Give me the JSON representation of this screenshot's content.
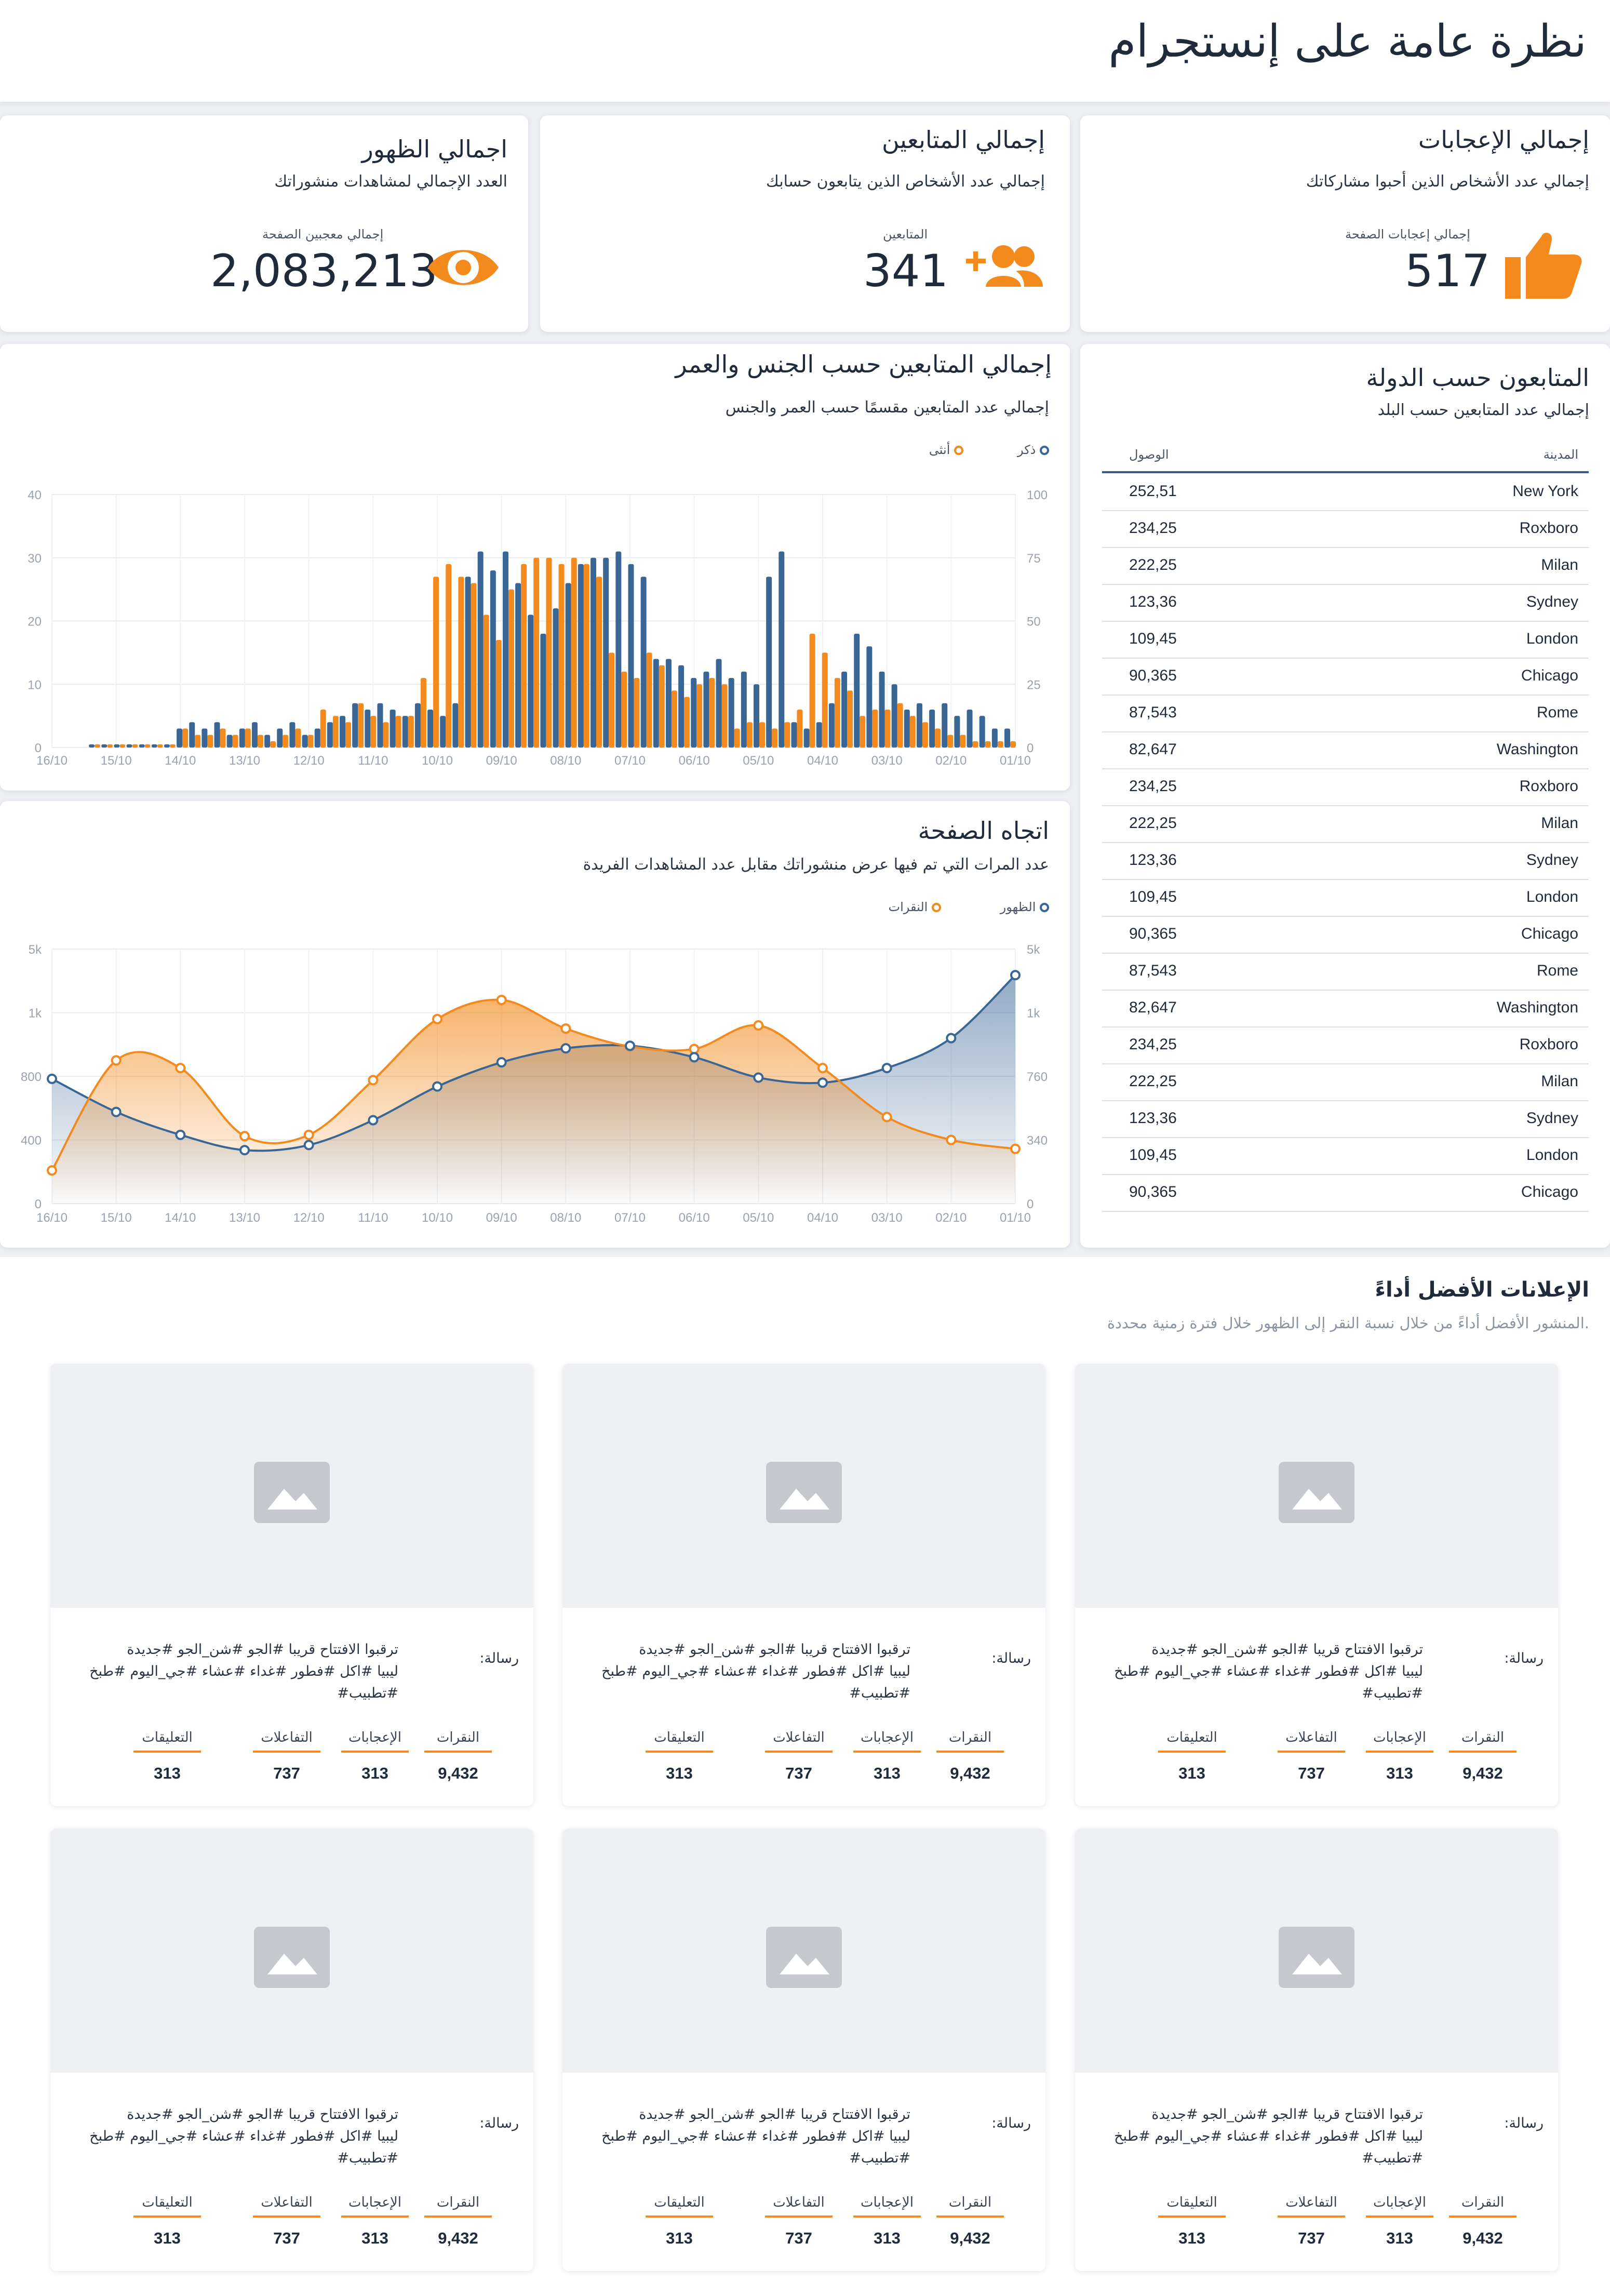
{
  "page": {
    "title": "نظرة عامة على إنستجرام"
  },
  "colors": {
    "accent": "#f28a1d",
    "primary": "#3a6696",
    "background": "#eef0f4",
    "card": "#ffffff"
  },
  "kpis": {
    "likes": {
      "title": "إجمالي الإعجابات",
      "subtitle": "إجمالي عدد الأشخاص الذين أحبوا مشاركاتك",
      "metric_label": "إجمالي إعجابات الصفحة",
      "value": "517",
      "icon": "thumbs-up-icon"
    },
    "followers": {
      "title": "إجمالي المتابعين",
      "subtitle": "إجمالي عدد الأشخاص الذين يتابعون حسابك",
      "metric_label": "المتابعين",
      "value": "341",
      "icon": "add-users-icon"
    },
    "impressions": {
      "title": "اجمالي الظهور",
      "subtitle": "العدد الإجمالي لمشاهدات منشوراتك",
      "metric_label": "إجمالي معجبين الصفحة",
      "value": "2,083,213",
      "icon": "eye-icon"
    }
  },
  "country_table": {
    "title": "المتابعون حسب الدولة",
    "subtitle": "إجمالي عدد المتابعين حسب البلد",
    "col_city": "المدينة",
    "col_reach": "الوصول",
    "rows": [
      {
        "city": "New York",
        "value": "252,51"
      },
      {
        "city": "Roxboro",
        "value": "234,25"
      },
      {
        "city": "Milan",
        "value": "222,25"
      },
      {
        "city": "Sydney",
        "value": "123,36"
      },
      {
        "city": "London",
        "value": "109,45"
      },
      {
        "city": "Chicago",
        "value": "90,365"
      },
      {
        "city": "Rome",
        "value": "87,543"
      },
      {
        "city": "Washington",
        "value": "82,647"
      },
      {
        "city": "Roxboro",
        "value": "234,25"
      },
      {
        "city": "Milan",
        "value": "222,25"
      },
      {
        "city": "Sydney",
        "value": "123,36"
      },
      {
        "city": "London",
        "value": "109,45"
      },
      {
        "city": "Chicago",
        "value": "90,365"
      },
      {
        "city": "Rome",
        "value": "87,543"
      },
      {
        "city": "Washington",
        "value": "82,647"
      },
      {
        "city": "Roxboro",
        "value": "234,25"
      },
      {
        "city": "Milan",
        "value": "222,25"
      },
      {
        "city": "Sydney",
        "value": "123,36"
      },
      {
        "city": "London",
        "value": "109,45"
      },
      {
        "city": "Chicago",
        "value": "90,365"
      }
    ]
  },
  "chart_data": [
    {
      "type": "bar",
      "title": "إجمالي المتابعين حسب الجنس والعمر",
      "subtitle": "إجمالي عدد المتابعين مقسمًا حسب العمر والجنس",
      "x_ticks": [
        "16/10",
        "15/10",
        "14/10",
        "13/10",
        "12/10",
        "11/10",
        "10/10",
        "09/10",
        "08/10",
        "07/10",
        "06/10",
        "05/10",
        "04/10",
        "03/10",
        "02/10",
        "01/10"
      ],
      "y_left_ticks": [
        "0",
        "10",
        "20",
        "30",
        "40"
      ],
      "y_right_ticks": [
        "0",
        "25",
        "50",
        "75",
        "100"
      ],
      "ylim": [
        0,
        40
      ],
      "legend_position": "top-right",
      "grid": true,
      "series": [
        {
          "name": "ذكر",
          "color": "#3a6696",
          "values": [
            0.5,
            0.5,
            0.5,
            0.5,
            0.5,
            0.5,
            0.5,
            3,
            4,
            3,
            4,
            2,
            3,
            4,
            2,
            3,
            4,
            2,
            3,
            4,
            5,
            7,
            6,
            7,
            6,
            5,
            7,
            6,
            5,
            7,
            27,
            31,
            28,
            31,
            26,
            21,
            18,
            22,
            26,
            29,
            30,
            30,
            31,
            29,
            27,
            14,
            14,
            13,
            11,
            12,
            14,
            11,
            12,
            10,
            27,
            31,
            4,
            3,
            4,
            7,
            12,
            18,
            16,
            12,
            10,
            6,
            7,
            6,
            7,
            5,
            6,
            5,
            3,
            3
          ]
        },
        {
          "name": "أنثى",
          "color": "#f28a1d",
          "values": [
            0.5,
            0.5,
            0.5,
            0.5,
            0.5,
            0.5,
            0.5,
            3,
            2,
            2,
            3,
            2,
            3,
            2,
            1,
            2,
            3,
            2,
            6,
            5,
            4,
            7,
            5,
            4,
            5,
            5,
            11,
            27,
            29,
            27,
            26,
            21,
            17,
            25,
            29,
            30,
            30,
            29,
            30,
            29,
            27,
            15,
            12,
            11,
            15,
            13,
            9,
            8,
            10,
            11,
            10,
            3,
            4,
            4,
            3,
            4,
            6,
            18,
            15,
            11,
            9,
            5,
            6,
            6,
            7,
            5,
            4,
            3,
            2,
            2,
            1,
            1,
            1,
            1
          ]
        }
      ]
    },
    {
      "type": "area",
      "title": "اتجاه الصفحة",
      "subtitle": "عدد المرات التي تم فيها عرض منشوراتك مقابل عدد المشاهدات الفريدة",
      "x_ticks": [
        "16/10",
        "15/10",
        "14/10",
        "13/10",
        "12/10",
        "11/10",
        "10/10",
        "09/10",
        "08/10",
        "07/10",
        "06/10",
        "05/10",
        "04/10",
        "03/10",
        "02/10",
        "01/10"
      ],
      "y_left_ticks": [
        "0",
        "400",
        "800",
        "1k",
        "5k"
      ],
      "y_right_ticks": [
        "0",
        "340",
        "760",
        "1k",
        "5k"
      ],
      "legend_position": "top-right",
      "grid": true,
      "series": [
        {
          "name": "الظهور",
          "color": "#3a6696",
          "values": [
            196,
            144,
            108,
            84,
            92,
            131,
            184,
            222,
            244,
            248,
            230,
            198,
            190,
            213,
            260,
            359
          ]
        },
        {
          "name": "النقرات",
          "color": "#f28a1d",
          "values": [
            52,
            225,
            213,
            106,
            108,
            194,
            290,
            320,
            275,
            247,
            243,
            280,
            213,
            136,
            100,
            86
          ]
        }
      ]
    }
  ],
  "ads": {
    "title": "الإعلانات الأفضل أداءً",
    "subtitle": ".المنشور الأفضل أداءً من خلال نسبة النقر إلى الظهور خلال فترة زمنية محددة",
    "message_label": "رسالة:",
    "stat_labels": {
      "clicks": "النقرات",
      "likes": "الإعجابات",
      "interactions": "التفاعلات",
      "comments": "التعليقات"
    },
    "items": [
      {
        "message_line1": "ترقبوا الافتتاح قريبا #الجو #شن_الجو #جديدة",
        "message_line2": "ليبيا #اكل #فطور #غداء #عشاء #جي_اليوم #طبخ #تطبيب#",
        "clicks": "9,432",
        "likes": "313",
        "interactions": "737",
        "comments": "313"
      },
      {
        "message_line1": "ترقبوا الافتتاح قريبا #الجو #شن_الجو #جديدة",
        "message_line2": "ليبيا #اكل #فطور #غداء #عشاء #جي_اليوم #طبخ #تطبيب#",
        "clicks": "9,432",
        "likes": "313",
        "interactions": "737",
        "comments": "313"
      },
      {
        "message_line1": "ترقبوا الافتتاح قريبا #الجو #شن_الجو #جديدة",
        "message_line2": "ليبيا #اكل #فطور #غداء #عشاء #جي_اليوم #طبخ #تطبيب#",
        "clicks": "9,432",
        "likes": "313",
        "interactions": "737",
        "comments": "313"
      },
      {
        "message_line1": "ترقبوا الافتتاح قريبا #الجو #شن_الجو #جديدة",
        "message_line2": "ليبيا #اكل #فطور #غداء #عشاء #جي_اليوم #طبخ #تطبيب#",
        "clicks": "9,432",
        "likes": "313",
        "interactions": "737",
        "comments": "313"
      },
      {
        "message_line1": "ترقبوا الافتتاح قريبا #الجو #شن_الجو #جديدة",
        "message_line2": "ليبيا #اكل #فطور #غداء #عشاء #جي_اليوم #طبخ #تطبيب#",
        "clicks": "9,432",
        "likes": "313",
        "interactions": "737",
        "comments": "313"
      },
      {
        "message_line1": "ترقبوا الافتتاح قريبا #الجو #شن_الجو #جديدة",
        "message_line2": "ليبيا #اكل #فطور #غداء #عشاء #جي_اليوم #طبخ #تطبيب#",
        "clicks": "9,432",
        "likes": "313",
        "interactions": "737",
        "comments": "313"
      }
    ]
  }
}
